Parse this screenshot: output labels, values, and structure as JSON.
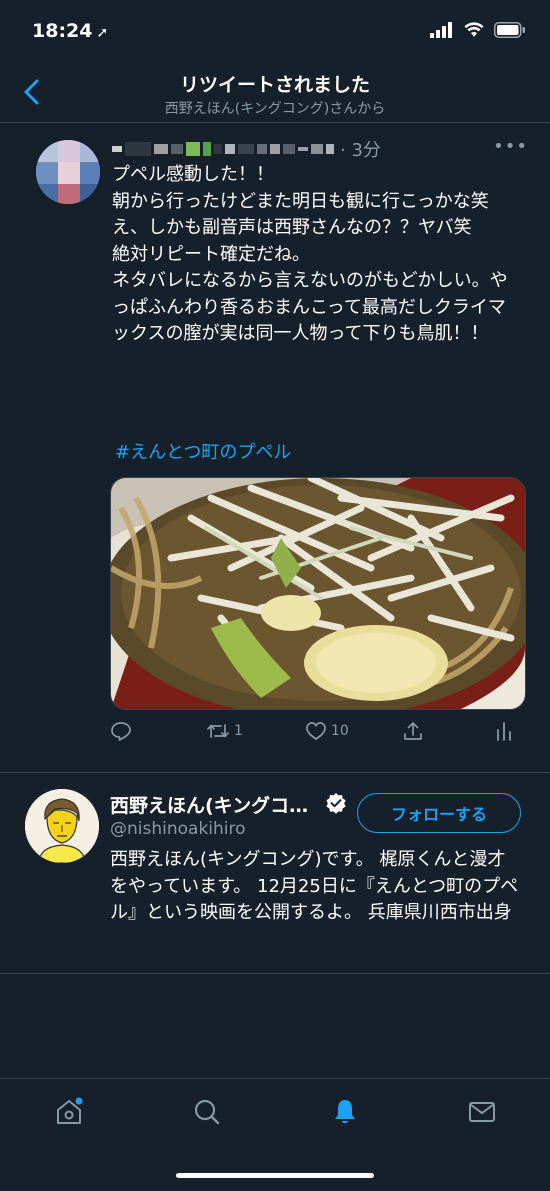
{
  "status_bar": {
    "time": "18:24"
  },
  "header": {
    "title": "リツイートされました",
    "subtitle": "西野えほん(キングコング)さんから"
  },
  "tweet": {
    "time": "· 3分",
    "text": "プペル感動した！！\n朝から行ったけどまた明日も観に行こっかな笑\nえ、しかも副音声は西野さんなの？？ヤバ笑\n絶対リピート確定だね。\nネタバレになるから言えないのがもどかしい。やっぱふんわり香るおまんこって最高だしクライマックスの膣が実は同一人物って下りも鳥肌！！",
    "hashtag": "#えんとつ町のプペル",
    "retweets": "1",
    "likes": "10"
  },
  "profile_card": {
    "name": "西野えほん(キングコ…",
    "handle": "@nishinoakihiro",
    "follow_label": "フォローする",
    "bio": "西野えほん(キングコング)です。 梶原くんと漫才をやっています。 12月25日に『えんとつ町のプペル』という映画を公開するよ。 兵庫県川西市出身"
  },
  "colors": {
    "background": "#15202b",
    "accent": "#1da1f2",
    "secondary_text": "#8899a6",
    "divider": "#38444d"
  },
  "icons": [
    "back-icon",
    "more-icon",
    "reply-icon",
    "retweet-icon",
    "like-icon",
    "share-icon",
    "analytics-icon",
    "verified-icon",
    "home-icon",
    "search-icon",
    "notifications-icon",
    "messages-icon"
  ]
}
